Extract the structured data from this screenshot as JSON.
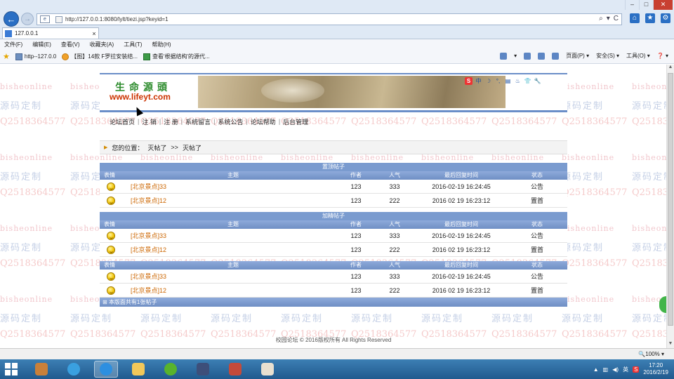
{
  "browser": {
    "url": "http://127.0.0.1:8080/lylt/tiezi.jsp?keyid=1",
    "tab_label": "127.0.0.1",
    "tab_close": "×",
    "back": "←",
    "forward": "→",
    "minimize": "–",
    "maximize": "□",
    "close": "✕",
    "addr_tools": [
      "⌕",
      "▾",
      "C"
    ],
    "addr_ico": "e",
    "right_icons": [
      "⌂",
      "★",
      "⚙"
    ],
    "menu": [
      "文件(F)",
      "编辑(E)",
      "查看(V)",
      "收藏夹(A)",
      "工具(T)",
      "帮助(H)"
    ],
    "favorites": [
      "http--127.0.0",
      "【图】14款 F罗拉安装结...",
      "查看'根据结构'的源代..."
    ],
    "commands": [
      "▾",
      "页面(P) ▾",
      "安全(S) ▾",
      "工具(O) ▾",
      "❓ ▾"
    ]
  },
  "site": {
    "logo_title": "生命源頭",
    "logo_url": "www.lifeyt.com",
    "toolbox": [
      "S",
      "中",
      "☽",
      "°,",
      "▤",
      "♨",
      "👕",
      "🔧"
    ],
    "nav": [
      "论坛首页",
      "注 销",
      "注 册",
      "系统留言",
      "系统公告",
      "论坛帮助",
      "后台管理"
    ],
    "breadcrumb_arrow": "▶",
    "breadcrumb_label": "您的位置：",
    "breadcrumb_link": "灭帖了",
    "breadcrumb_sep": ">>",
    "breadcrumb_current": "灭帖了"
  },
  "forum": {
    "columns": [
      "表情",
      "主题",
      "作者",
      "人气",
      "最后回复时间",
      "状态"
    ],
    "sections": [
      {
        "title": "置顶帖子",
        "rows": [
          {
            "title": "[北京景点]33",
            "author": "123",
            "views": "333",
            "time": "2016-02-19 16:24:45",
            "status": "公告"
          },
          {
            "title": "[北京景点]12",
            "author": "123",
            "views": "222",
            "time": "2016 02 19 16:23:12",
            "status": "置首"
          }
        ]
      },
      {
        "title": "加精帖子",
        "rows": [
          {
            "title": "[北京景点]33",
            "author": "123",
            "views": "333",
            "time": "2016-02-19 16:24:45",
            "status": "公告"
          },
          {
            "title": "[北京景点]12",
            "author": "123",
            "views": "222",
            "time": "2016 02 19 16:23:12",
            "status": "置首"
          }
        ]
      },
      {
        "title": "",
        "rows": [
          {
            "title": "[北京景点]33",
            "author": "123",
            "views": "333",
            "time": "2016-02-19 16:24:45",
            "status": "公告"
          },
          {
            "title": "[北京景点]12",
            "author": "123",
            "views": "222",
            "time": "2016 02 19 16:23:12",
            "status": "置首"
          }
        ]
      }
    ],
    "stat_text": "本版面共有1张帖子",
    "footer": "校园论坛 © 2016版权所有  All Rights Reserved"
  },
  "watermark": {
    "line_a": "bisheonline",
    "line_b": "源码定制",
    "line_c": "Q2518364577"
  },
  "status": {
    "zoom": "🔍100%  ▾"
  },
  "taskbar": {
    "time": "17:20",
    "date": "2016/2/19",
    "ime": "英"
  }
}
